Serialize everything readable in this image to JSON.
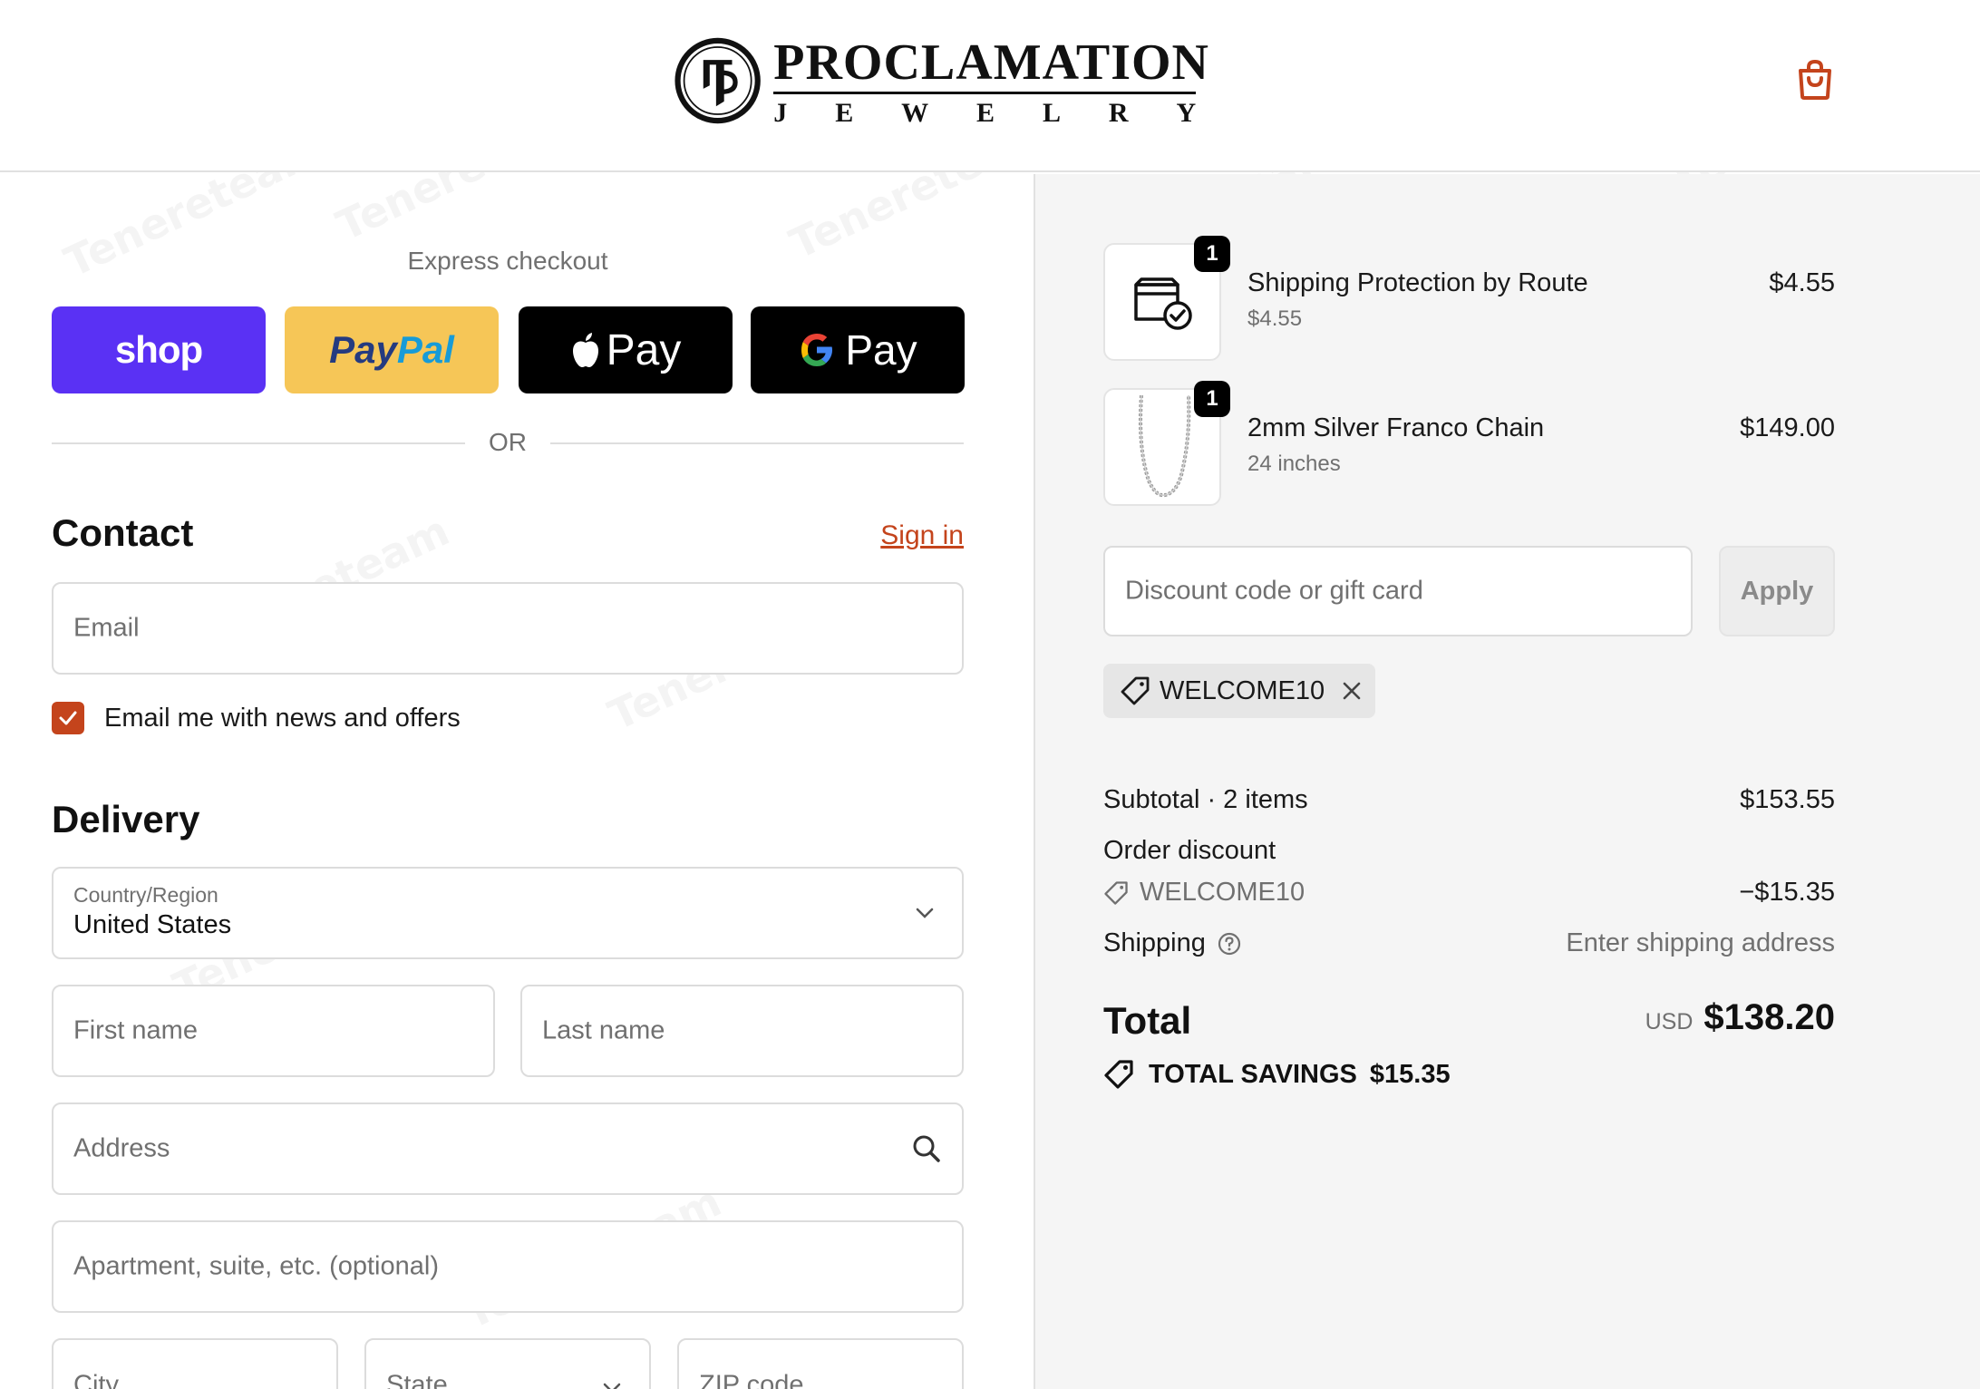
{
  "header": {
    "brand_name": "PROCLAMATION",
    "brand_sub": [
      "J",
      "E",
      "W",
      "E",
      "L",
      "R",
      "Y"
    ],
    "brand_accent": "#c4441c"
  },
  "express": {
    "title": "Express checkout",
    "shop_label": "shop",
    "paypal_label_1": "Pay",
    "paypal_label_2": "Pal",
    "apple_pay_label": "Pay",
    "google_pay_label": "Pay",
    "or_label": "OR"
  },
  "contact": {
    "title": "Contact",
    "sign_in": "Sign in",
    "email_placeholder": "Email",
    "newsletter_label": "Email me with news and offers",
    "newsletter_checked": true
  },
  "delivery": {
    "title": "Delivery",
    "country_label": "Country/Region",
    "country_value": "United States",
    "first_name_placeholder": "First name",
    "last_name_placeholder": "Last name",
    "address_placeholder": "Address",
    "apartment_placeholder": "Apartment, suite, etc. (optional)",
    "city_placeholder": "City",
    "state_placeholder": "State",
    "zip_placeholder": "ZIP code"
  },
  "cart": {
    "items": [
      {
        "name": "Shipping Protection by Route",
        "subtitle": "$4.55",
        "price": "$4.55",
        "quantity": "1",
        "icon": "package-check-icon"
      },
      {
        "name": "2mm Silver Franco Chain",
        "subtitle": "24 inches",
        "price": "$149.00",
        "quantity": "1",
        "icon": "chain-image"
      }
    ],
    "discount_placeholder": "Discount code or gift card",
    "apply_label": "Apply",
    "applied_code": "WELCOME10"
  },
  "summary": {
    "subtotal_label": "Subtotal · 2 items",
    "subtotal_value": "$153.55",
    "order_discount_label": "Order discount",
    "discount_code": "WELCOME10",
    "discount_value": "−$15.35",
    "shipping_label": "Shipping",
    "shipping_value": "Enter shipping address",
    "total_label": "Total",
    "total_currency": "USD",
    "total_value": "$138.20",
    "savings_label": "TOTAL SAVINGS",
    "savings_value": "$15.35"
  },
  "colors": {
    "shop_pay": "#5a31f4",
    "paypal": "#f6c657",
    "accent": "#c4441c",
    "panel_bg": "#f5f5f5"
  }
}
